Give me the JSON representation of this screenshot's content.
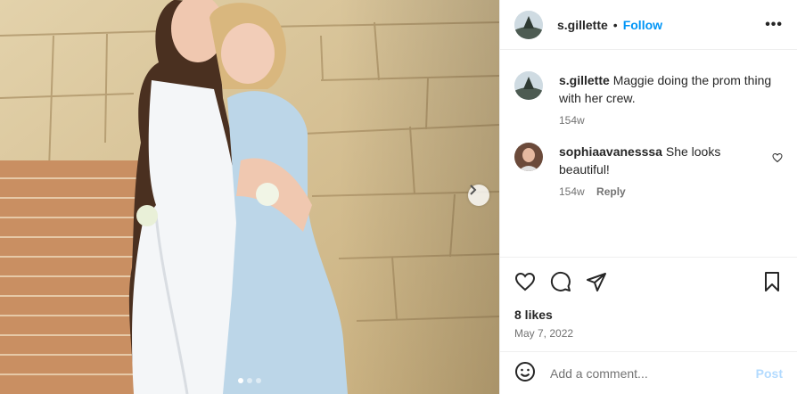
{
  "post": {
    "username": "s.gillette",
    "separator": "•",
    "follow_label": "Follow",
    "more_label": "•••"
  },
  "caption": {
    "username": "s.gillette",
    "text": "Maggie doing the prom thing with her crew.",
    "time": "154w"
  },
  "comments": [
    {
      "username": "sophiaavanesssa",
      "text": "She looks beautiful!",
      "time": "154w",
      "reply_label": "Reply"
    }
  ],
  "likes": "8 likes",
  "date": "May 7, 2022",
  "add_comment": {
    "placeholder": "Add a comment...",
    "post_label": "Post"
  },
  "carousel": {
    "slide_count": 3,
    "active_index": 0
  },
  "colors": {
    "accent": "#0095f6",
    "muted": "#737373",
    "post_disabled": "#b3dbff"
  },
  "icons": [
    "chevron-right-icon",
    "heart-icon",
    "comment-icon",
    "share-icon",
    "bookmark-icon",
    "emoji-icon",
    "more-icon"
  ]
}
